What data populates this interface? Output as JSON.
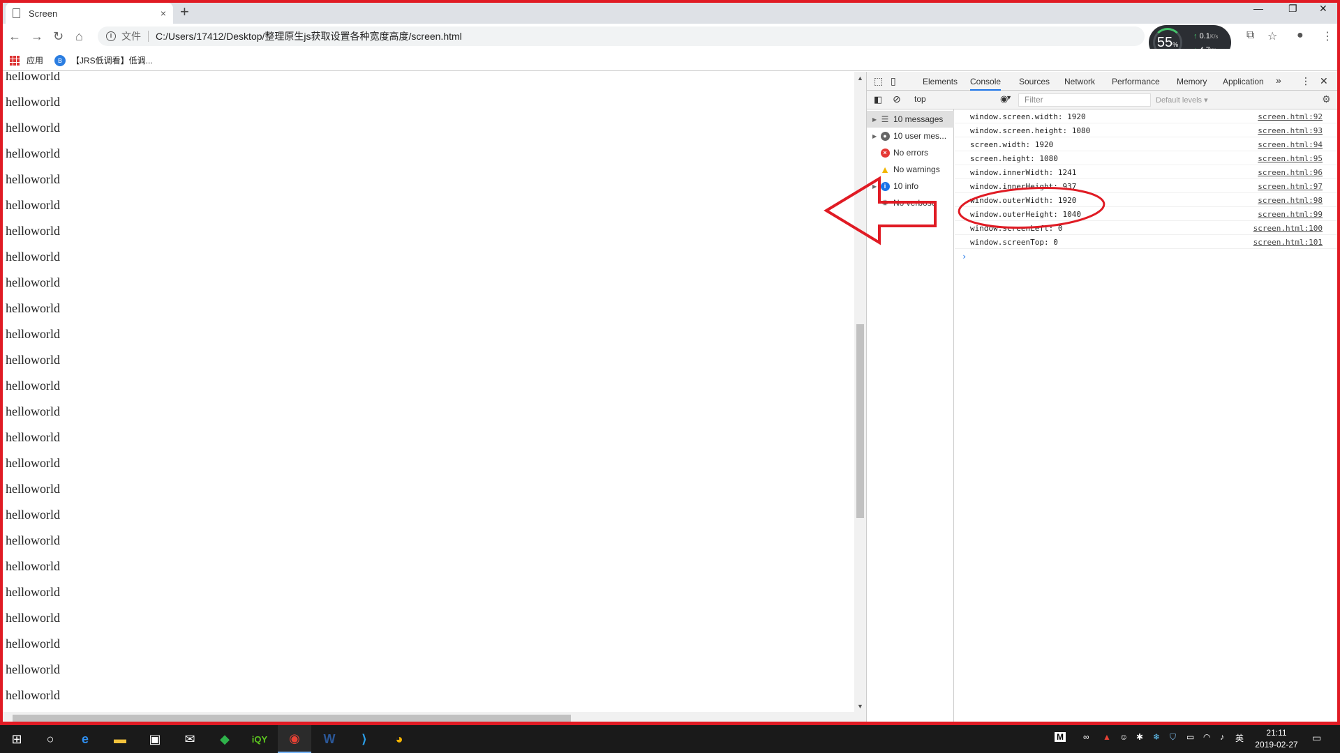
{
  "browser": {
    "tab_title": "Screen",
    "close_tab": "×",
    "new_tab": "+",
    "window_controls": {
      "minimize": "—",
      "maximize": "❐",
      "close": "✕"
    },
    "scheme_label": "文件",
    "url": "C:/Users/17412/Desktop/整理原生js获取设置各种宽度高度/screen.html",
    "bookmarks": {
      "apps_label": "应用",
      "item_1": "【JRS低调看】低调..."
    }
  },
  "net_monitor": {
    "cpu": "55",
    "cpu_unit": "%",
    "up": "0.1",
    "down": "4.7",
    "rate_unit": "K/s"
  },
  "page": {
    "lines": [
      "helloworld",
      "helloworld",
      "helloworld",
      "helloworld",
      "helloworld",
      "helloworld",
      "helloworld",
      "helloworld",
      "helloworld",
      "helloworld",
      "helloworld",
      "helloworld",
      "helloworld",
      "helloworld",
      "helloworld",
      "helloworld",
      "helloworld",
      "helloworld",
      "helloworld",
      "helloworld",
      "helloworld",
      "helloworld",
      "helloworld",
      "helloworld",
      "helloworld"
    ]
  },
  "devtools": {
    "tabs": [
      "Elements",
      "Console",
      "Sources",
      "Network",
      "Performance",
      "Memory",
      "Application"
    ],
    "active_tab": "Console",
    "more": "»",
    "context": "top",
    "filter_placeholder": "Filter",
    "levels": "Default levels ▾",
    "sidebar": [
      {
        "label": "10 messages",
        "icon": "list-icon",
        "expandable": true,
        "selected": true
      },
      {
        "label": "10 user mes...",
        "icon": "user-icon",
        "expandable": true,
        "selected": false
      },
      {
        "label": "No errors",
        "icon": "error-icon",
        "expandable": false,
        "selected": false
      },
      {
        "label": "No warnings",
        "icon": "warning-icon",
        "expandable": false,
        "selected": false
      },
      {
        "label": "10 info",
        "icon": "info-icon",
        "expandable": true,
        "selected": false
      },
      {
        "label": "No verbose",
        "icon": "bug-icon",
        "expandable": false,
        "selected": false
      }
    ],
    "messages": [
      {
        "text": "window.screen.width: 1920",
        "source": "screen.html:92"
      },
      {
        "text": "window.screen.height: 1080",
        "source": "screen.html:93"
      },
      {
        "text": "screen.width: 1920",
        "source": "screen.html:94"
      },
      {
        "text": "screen.height: 1080",
        "source": "screen.html:95"
      },
      {
        "text": "window.innerWidth: 1241",
        "source": "screen.html:96"
      },
      {
        "text": "window.innerHeight: 937",
        "source": "screen.html:97"
      },
      {
        "text": "window.outerWidth: 1920",
        "source": "screen.html:98"
      },
      {
        "text": "window.outerHeight: 1040",
        "source": "screen.html:99"
      },
      {
        "text": "window.screenLeft: 0",
        "source": "screen.html:100"
      },
      {
        "text": "window.screenTop: 0",
        "source": "screen.html:101"
      }
    ],
    "prompt": "›"
  },
  "taskbar": {
    "ime": "英",
    "tray_m": "M",
    "time": "21:11",
    "date": "2019-02-27"
  },
  "colors": {
    "annotation": "#e01b24",
    "accent": "#1a73e8",
    "taskbar": "#1a1a1a"
  }
}
